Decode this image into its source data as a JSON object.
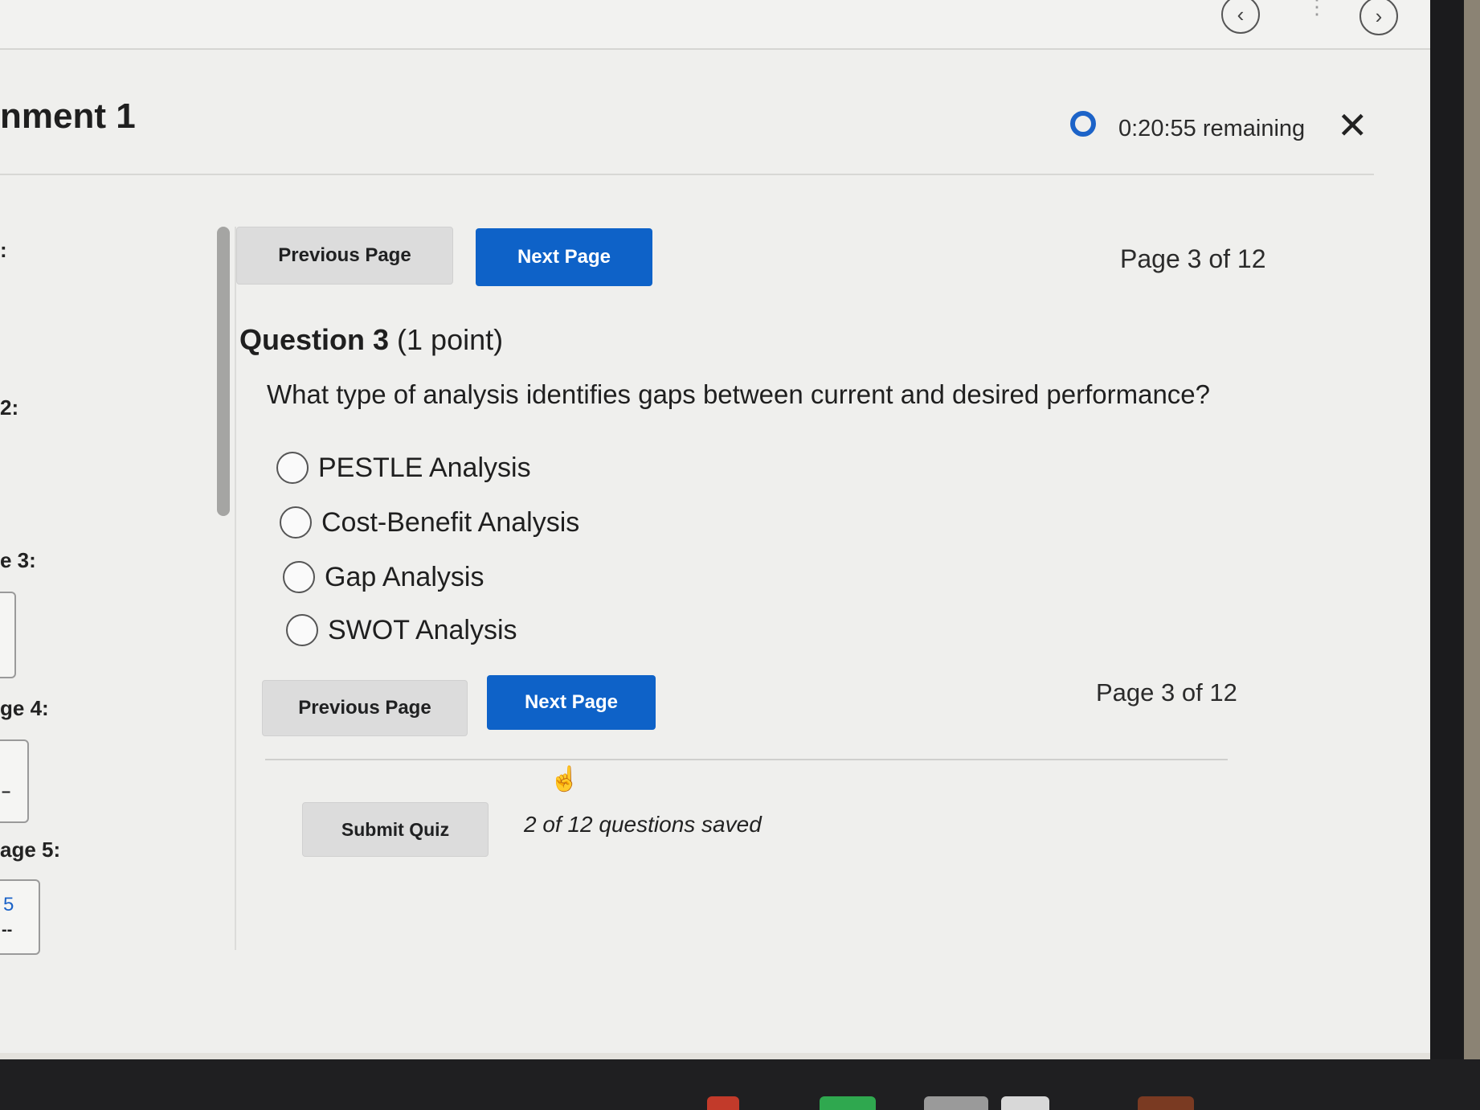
{
  "window": {
    "nav_prev_icon": "chevron-left-icon",
    "nav_next_icon": "chevron-right-icon",
    "more_icon": "more-vertical-icon"
  },
  "header": {
    "title": "nment 1",
    "timer": "0:20:55 remaining",
    "close_icon": "close-icon"
  },
  "sidebar": {
    "items": [
      {
        "label": ":"
      },
      {
        "label": "2:"
      },
      {
        "label": "e 3:"
      },
      {
        "label": "ge 4:"
      },
      {
        "label": "age 5:"
      }
    ],
    "box_values": [
      "–",
      "5",
      "--"
    ]
  },
  "nav_top": {
    "previous_label": "Previous Page",
    "next_label": "Next Page",
    "page_indicator": "Page 3 of 12"
  },
  "question": {
    "number_label": "Question 3",
    "points_label": "(1 point)",
    "text": "What type of analysis identifies gaps between current and desired performance?",
    "options": [
      {
        "label": "PESTLE Analysis",
        "selected": false
      },
      {
        "label": "Cost-Benefit Analysis",
        "selected": false
      },
      {
        "label": "Gap Analysis",
        "selected": false
      },
      {
        "label": "SWOT Analysis",
        "selected": false
      }
    ]
  },
  "nav_bottom": {
    "previous_label": "Previous Page",
    "next_label": "Next Page",
    "page_indicator": "Page 3 of 12"
  },
  "footer": {
    "submit_label": "Submit Quiz",
    "saved_status": "2 of 12 questions saved"
  },
  "colors": {
    "primary": "#0e62c8",
    "secondary_button": "#dcdcdc",
    "background": "#efefed"
  }
}
